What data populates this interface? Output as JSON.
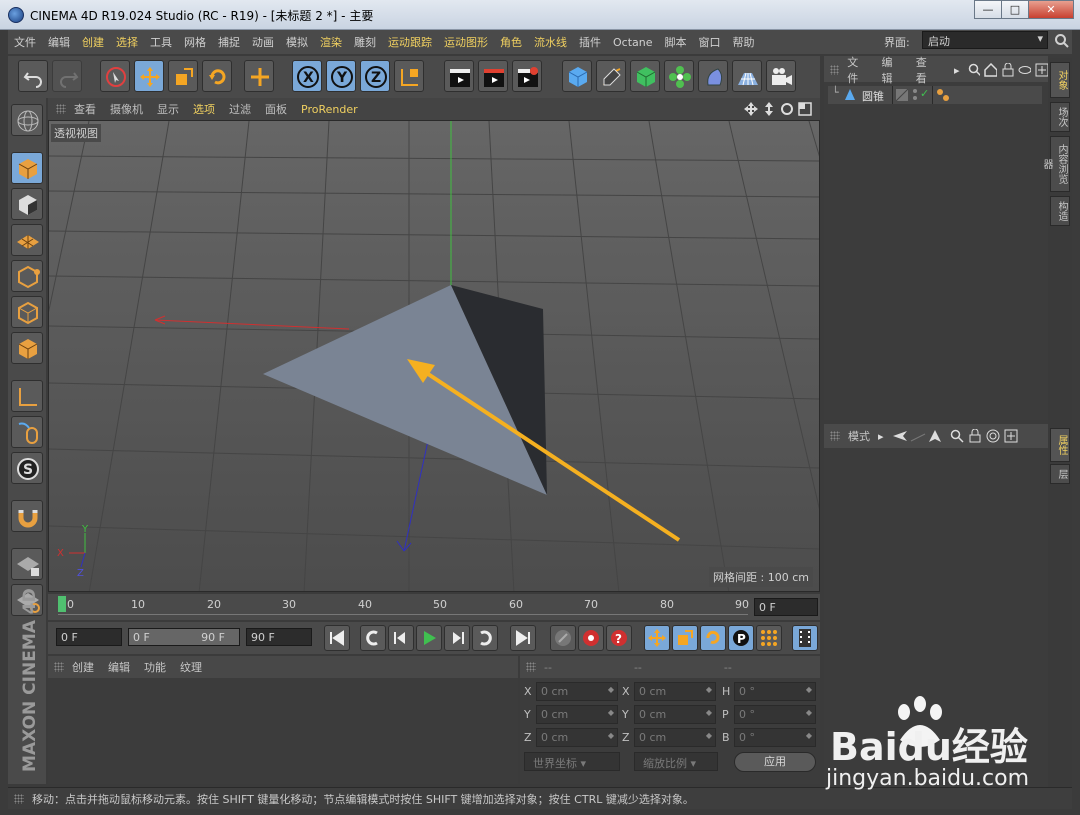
{
  "window": {
    "title": "CINEMA 4D R19.024 Studio (RC - R19) - [未标题 2 *] - 主要",
    "minimize": "—",
    "maximize": "□",
    "close": "✕"
  },
  "menubar": {
    "items": [
      "文件",
      "编辑",
      "创建",
      "选择",
      "工具",
      "网格",
      "捕捉",
      "动画",
      "模拟",
      "渲染",
      "雕刻",
      "运动跟踪",
      "运动图形",
      "角色",
      "流水线",
      "插件",
      "Octane",
      "脚本",
      "窗口",
      "帮助"
    ],
    "layout_label": "界面:",
    "layout_value": "启动"
  },
  "viewport": {
    "menu": [
      "查看",
      "摄像机",
      "显示",
      "选项",
      "过滤",
      "面板",
      "ProRender"
    ],
    "label": "透视视图",
    "grid_info": "网格间距 : 100 cm",
    "axis_x": "X",
    "axis_y": "Y",
    "axis_z": "Z"
  },
  "timeline": {
    "ticks": [
      "0",
      "10",
      "20",
      "30",
      "40",
      "50",
      "60",
      "70",
      "80",
      "90"
    ],
    "current_frame": "0 F",
    "start_field": "0 F",
    "range_start": "0 F",
    "range_end": "90 F",
    "end_field": "90 F"
  },
  "material_panel": {
    "menu": [
      "创建",
      "编辑",
      "功能",
      "纹理"
    ]
  },
  "coords": {
    "headers": [
      "--",
      "--",
      "--"
    ],
    "labels_pos": [
      "X",
      "Y",
      "Z"
    ],
    "labels_size": [
      "X",
      "Y",
      "Z"
    ],
    "labels_rot": [
      "H",
      "P",
      "B"
    ],
    "pos": [
      "0 cm",
      "0 cm",
      "0 cm"
    ],
    "size": [
      "0 cm",
      "0 cm",
      "0 cm"
    ],
    "rot": [
      "0 °",
      "0 °",
      "0 °"
    ],
    "world": "世界坐标",
    "scale": "缩放比例",
    "apply": "应用"
  },
  "object_panel": {
    "menu": [
      "文件",
      "编辑",
      "查看"
    ],
    "object_name": "圆锥"
  },
  "attr_panel": {
    "mode": "模式"
  },
  "right_tabs": [
    "对象",
    "场次",
    "内容浏览器",
    "构造",
    "属性",
    "层"
  ],
  "status": "移动：点击并拖动鼠标移动元素。按住 SHIFT 键量化移动；节点编辑模式时按住 SHIFT 键增加选择对象；按住 CTRL 键减少选择对象。",
  "branding": "MAXON CINEMA 4D",
  "watermark": {
    "logo": "Baidu经验",
    "url": "jingyan.baidu.com"
  },
  "colors": {
    "accent": "#f0d060",
    "arrow": "#f5a623",
    "selected": "#7aa8d8"
  }
}
